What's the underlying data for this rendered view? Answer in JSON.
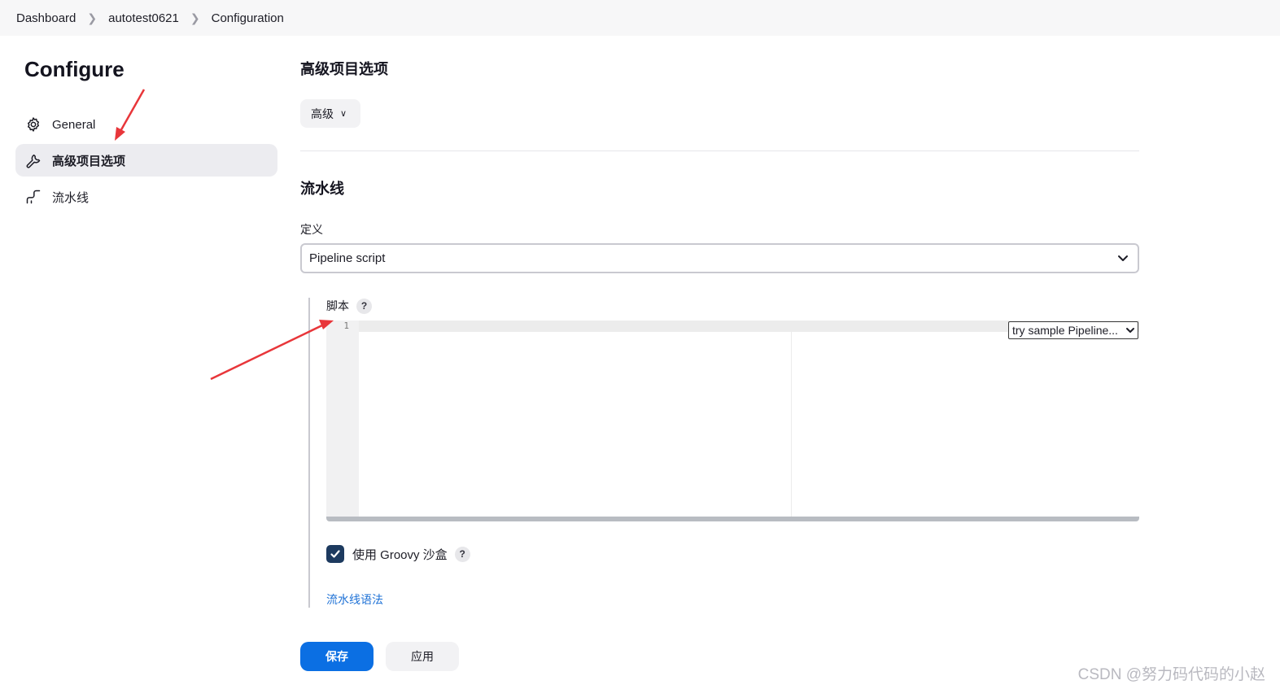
{
  "breadcrumb": {
    "items": [
      "Dashboard",
      "autotest0621",
      "Configuration"
    ]
  },
  "sidebar": {
    "title": "Configure",
    "items": [
      {
        "label": "General",
        "icon": "gear-icon",
        "active": false
      },
      {
        "label": "高级项目选项",
        "icon": "wrench-icon",
        "active": true
      },
      {
        "label": "流水线",
        "icon": "pipeline-icon",
        "active": false
      }
    ]
  },
  "advanced": {
    "title": "高级项目选项",
    "button_label": "高级"
  },
  "pipeline": {
    "title": "流水线",
    "definition_label": "定义",
    "definition_value": "Pipeline script",
    "script_label": "脚本",
    "help_mark": "?",
    "editor": {
      "line_number": "1",
      "sample_select": "try sample Pipeline..."
    },
    "groovy_sandbox_label": "使用 Groovy 沙盒",
    "groovy_sandbox_checked": true,
    "syntax_link": "流水线语法"
  },
  "actions": {
    "save_label": "保存",
    "apply_label": "应用"
  },
  "watermark": "CSDN @努力码代码的小赵",
  "colors": {
    "primary": "#0b6fe3",
    "link": "#1f72d6",
    "annotation_arrow": "#e8363a",
    "checkbox": "#1d3a5f"
  }
}
